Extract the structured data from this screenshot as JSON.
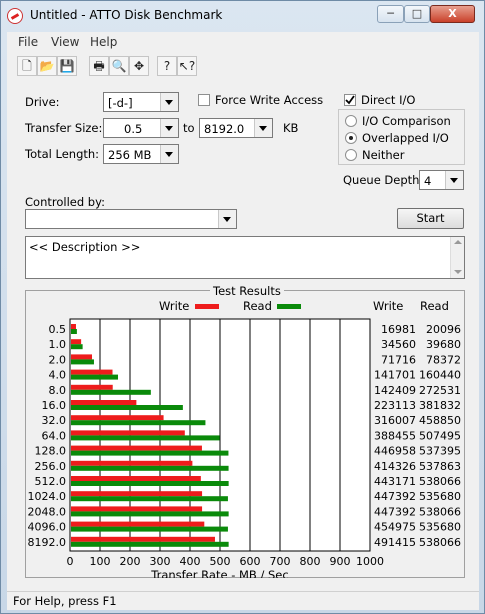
{
  "window": {
    "title": "Untitled - ATTO Disk Benchmark",
    "minimize": "─",
    "maximize": "□",
    "close": "X"
  },
  "menu": [
    "File",
    "View",
    "Help"
  ],
  "toolbar": [
    {
      "name": "new-icon",
      "glyph": "🗋"
    },
    {
      "name": "open-icon",
      "glyph": "📂"
    },
    {
      "name": "save-icon",
      "glyph": "💾"
    },
    {
      "name": "print-icon",
      "glyph": "🖶"
    },
    {
      "name": "print-preview-icon",
      "glyph": "🔍"
    },
    {
      "name": "move-icon",
      "glyph": "✥"
    },
    {
      "name": "help-icon",
      "glyph": "?"
    },
    {
      "name": "context-help-icon",
      "glyph": "↖?"
    }
  ],
  "form": {
    "drive_label": "Drive:",
    "drive_value": "[-d-]",
    "force_write_label": "Force Write Access",
    "direct_io_label": "Direct I/O",
    "transfer_size_label": "Transfer Size:",
    "transfer_from": "0.5",
    "to_label": "to",
    "transfer_to": "8192.0",
    "kb_label": "KB",
    "total_length_label": "Total Length:",
    "total_length_value": "256 MB",
    "io_comparison_label": "I/O Comparison",
    "overlapped_io_label": "Overlapped I/O",
    "neither_label": "Neither",
    "queue_depth_label": "Queue Depth:",
    "queue_depth_value": "4",
    "controlled_by_label": "Controlled by:",
    "controlled_by_value": "",
    "start_label": "Start",
    "description": "<< Description >>"
  },
  "results": {
    "title": "Test Results",
    "write_legend": "Write",
    "read_legend": "Read",
    "write_header": "Write",
    "read_header": "Read",
    "write_color": "#ee1c1c",
    "read_color": "#0a8a0a"
  },
  "chart_data": {
    "type": "bar",
    "orientation": "horizontal",
    "categories": [
      "0.5",
      "1.0",
      "2.0",
      "4.0",
      "8.0",
      "16.0",
      "32.0",
      "64.0",
      "128.0",
      "256.0",
      "512.0",
      "1024.0",
      "2048.0",
      "4096.0",
      "8192.0"
    ],
    "series": [
      {
        "name": "Write",
        "values": [
          16981,
          34560,
          71716,
          141701,
          142409,
          223113,
          316007,
          388455,
          446958,
          414326,
          443171,
          447392,
          447392,
          454975,
          491415
        ]
      },
      {
        "name": "Read",
        "values": [
          20096,
          39680,
          78372,
          160440,
          272531,
          381832,
          458850,
          507495,
          537395,
          537863,
          538066,
          535680,
          538066,
          535680,
          538066
        ]
      }
    ],
    "write_labels": [
      "16981",
      "34560",
      "71716",
      "141701",
      "142409",
      "223113",
      "316007",
      "388455",
      "446958",
      "414326",
      "443171",
      "447392",
      "447392",
      "454975",
      "491415"
    ],
    "read_labels": [
      "20096",
      "39680",
      "78372",
      "160440",
      "272531",
      "381832",
      "458850",
      "507495",
      "537395",
      "537863",
      "538066",
      "535680",
      "538066",
      "535680",
      "538066"
    ],
    "xticks": [
      "0",
      "100",
      "200",
      "300",
      "400",
      "500",
      "600",
      "700",
      "800",
      "900",
      "1000"
    ],
    "xlabel": "Transfer Rate - MB / Sec",
    "xlim": [
      0,
      1000
    ],
    "grid": true
  },
  "status": "For Help, press F1"
}
